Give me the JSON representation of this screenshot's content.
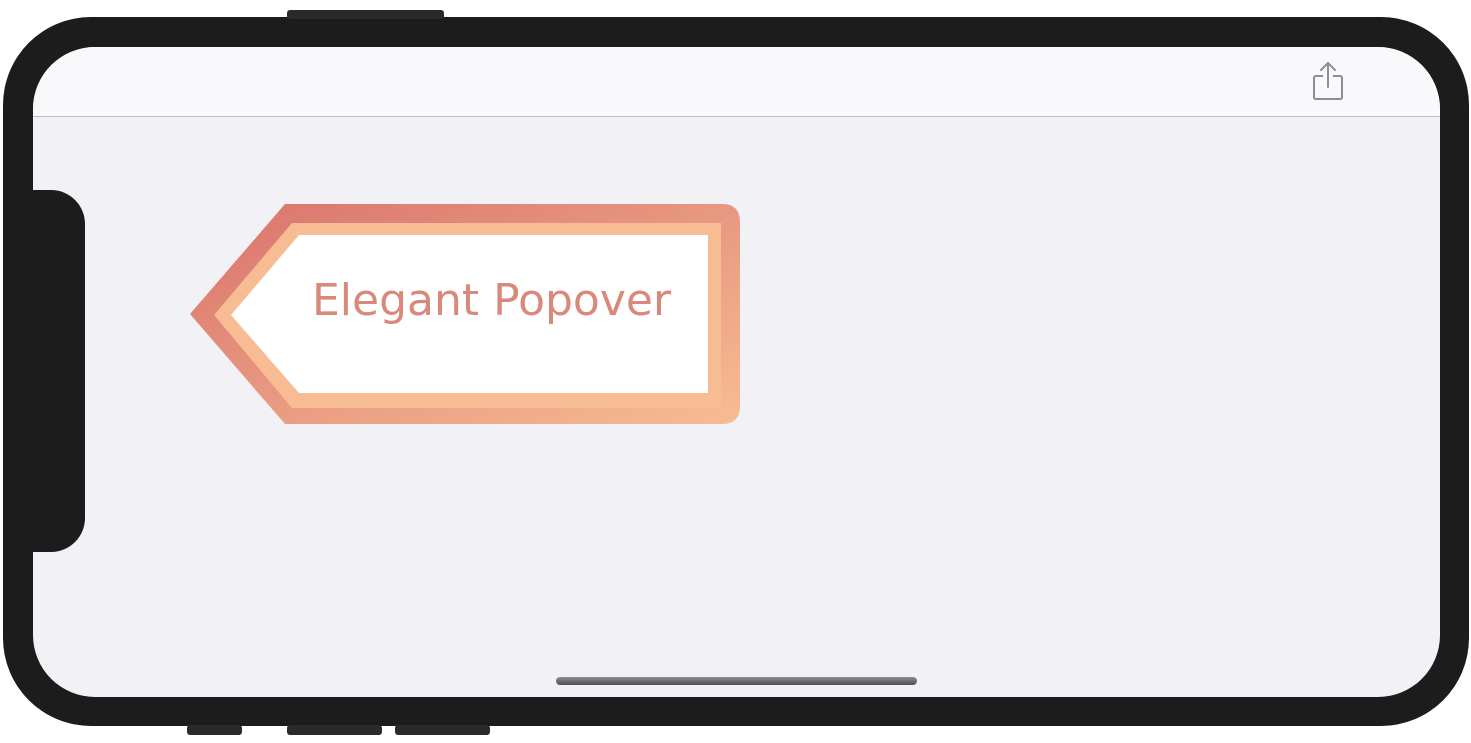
{
  "navigation": {
    "share_icon": "share-icon"
  },
  "popover": {
    "label": "Elegant Popover",
    "gradient_start": "#d9736d",
    "gradient_end": "#f7bc93",
    "text_color": "#d8897b",
    "fill": "#ffffff"
  },
  "colors": {
    "frame": "#1c1c1c",
    "screen_background": "#f2f1f6",
    "nav_background": "#f9f9fb",
    "icon_gray": "#8e8e93"
  }
}
